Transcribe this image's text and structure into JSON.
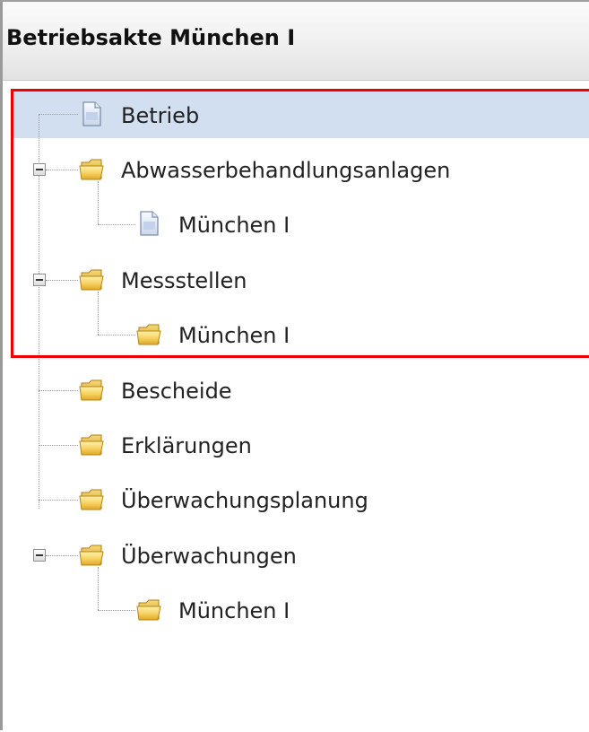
{
  "panel": {
    "title": "Betriebsakte München I"
  },
  "tree": {
    "betrieb": "Betrieb",
    "abwasser": "Abwasserbehandlungsanlagen",
    "abwasser_child": "München I",
    "messstellen": "Messstellen",
    "messstellen_child": "München I",
    "bescheide": "Bescheide",
    "erklaerungen": "Erklärungen",
    "ueberwachungsplanung": "Überwachungsplanung",
    "ueberwachungen": "Überwachungen",
    "ueberwachungen_child": "München I"
  },
  "icons": {
    "document": "document-icon",
    "folder": "folder-icon",
    "collapse": "collapse-icon"
  },
  "colors": {
    "selection": "#d2dff0",
    "highlight_border": "#ee0000",
    "folder": "#f2c23a"
  }
}
